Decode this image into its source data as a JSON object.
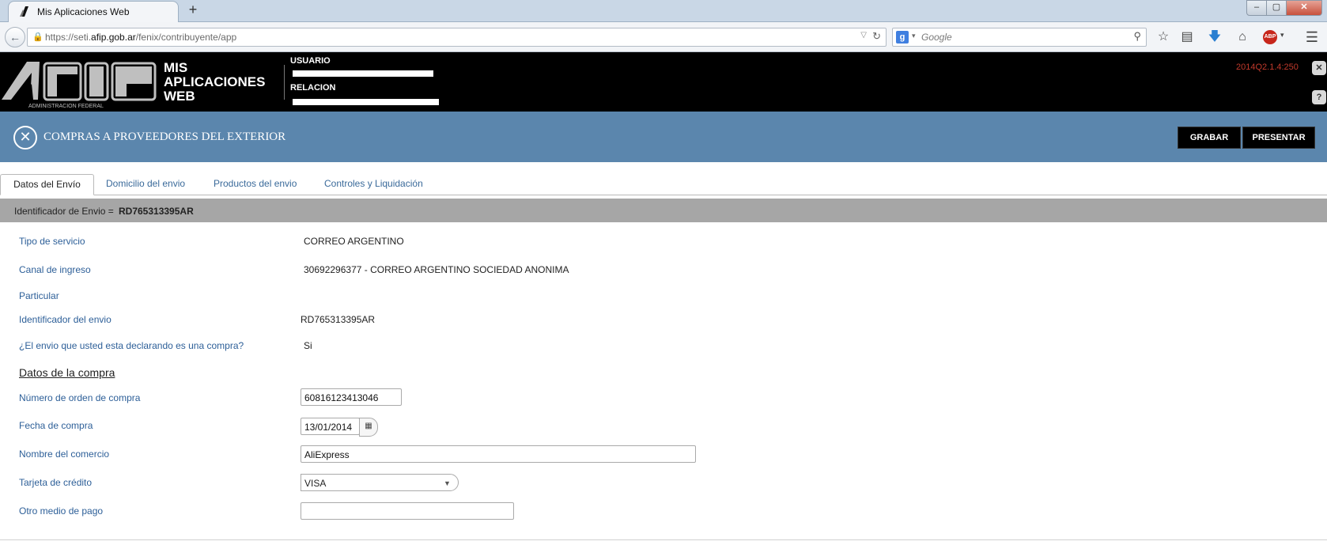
{
  "browser": {
    "tab_title": "Mis Aplicaciones Web",
    "new_tab": "+",
    "url_prefix": "https://seti.",
    "url_domain": "afip.gob.ar",
    "url_path": "/fenix/contribuyente/app",
    "search_placeholder": "Google",
    "window_controls": {
      "minimize": "–",
      "maximize": "▢",
      "close": "✕"
    }
  },
  "header": {
    "app_title_lines": [
      "MIS",
      "APLICACIONES",
      "WEB"
    ],
    "logo_caption": "ADMINISTRACION FEDERAL",
    "usuario_label": "USUARIO",
    "relacion_label": "RELACION",
    "version": "2014Q2.1.4:250",
    "close_btn": "✕",
    "help_btn": "?"
  },
  "band": {
    "title": "COMPRAS A PROVEEDORES DEL EXTERIOR",
    "close_icon": "✕",
    "grabar": "GRABAR",
    "presentar": "PRESENTAR"
  },
  "tabs": [
    "Datos del Envío",
    "Domicilio del envio",
    "Productos del envio",
    "Controles y Liquidación"
  ],
  "id_bar": {
    "label": "Identificador de Envio =",
    "value": "RD765313395AR"
  },
  "form": {
    "tipo_servicio": {
      "label": "Tipo de servicio",
      "value": "CORREO ARGENTINO"
    },
    "canal_ingreso": {
      "label": "Canal de ingreso",
      "value": "30692296377 - CORREO ARGENTINO SOCIEDAD ANONIMA"
    },
    "particular": {
      "label": "Particular"
    },
    "identificador": {
      "label": "Identificador del envio",
      "value": "RD765313395AR"
    },
    "es_compra": {
      "label": "¿El envio que usted esta declarando es una compra?",
      "value": "Si"
    },
    "section_title": "Datos de la compra",
    "orden_compra": {
      "label": "Número de orden de compra",
      "value": "60816123413046"
    },
    "fecha_compra": {
      "label": "Fecha de compra",
      "value": "13/01/2014"
    },
    "comercio": {
      "label": "Nombre del comercio",
      "value": "AliExpress"
    },
    "tarjeta": {
      "label": "Tarjeta de crédito",
      "value": "VISA"
    },
    "otro_medio": {
      "label": "Otro medio de pago",
      "value": ""
    }
  }
}
